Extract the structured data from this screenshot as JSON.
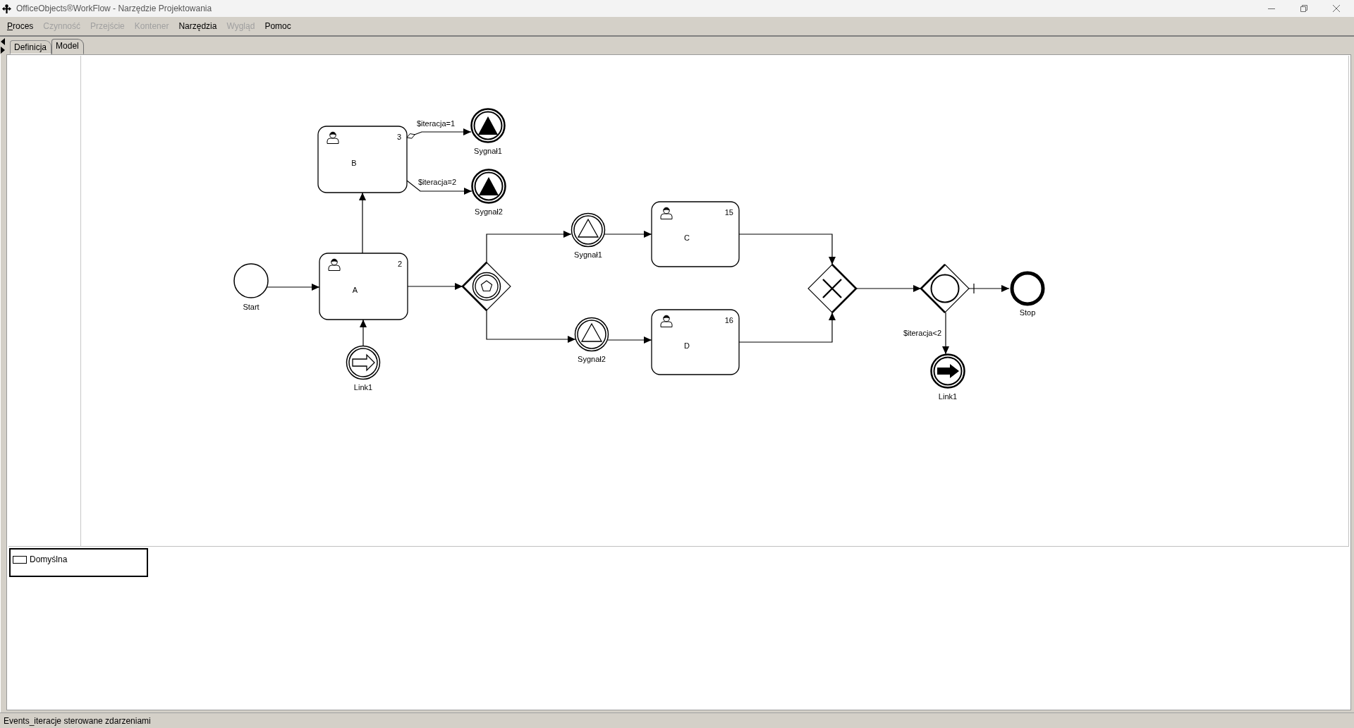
{
  "window": {
    "title": "OfficeObjects®WorkFlow - Narzędzie Projektowania"
  },
  "menu": [
    {
      "label": "Proces",
      "disabled": false,
      "mnemonic_underlined": true
    },
    {
      "label": "Czynność",
      "disabled": true,
      "mnemonic_underlined": false
    },
    {
      "label": "Przejście",
      "disabled": true,
      "mnemonic_underlined": false
    },
    {
      "label": "Kontener",
      "disabled": true,
      "mnemonic_underlined": false
    },
    {
      "label": "Narzędzia",
      "disabled": false,
      "mnemonic_underlined": false
    },
    {
      "label": "Wygląd",
      "disabled": true,
      "mnemonic_underlined": false
    },
    {
      "label": "Pomoc",
      "disabled": false,
      "mnemonic_underlined": false
    }
  ],
  "tabs": [
    {
      "label": "Definicja",
      "selected": false
    },
    {
      "label": "Model",
      "selected": true
    }
  ],
  "diagram": {
    "nodes": [
      {
        "kind": "task",
        "label": "B",
        "number": "3"
      },
      {
        "kind": "signal_end",
        "label": "Sygnał1"
      },
      {
        "kind": "signal_end",
        "label": "Sygnał2"
      },
      {
        "kind": "signal_catch",
        "label": "Sygnał1"
      },
      {
        "kind": "task",
        "label": "C",
        "number": "15"
      },
      {
        "kind": "start",
        "label": "Start"
      },
      {
        "kind": "task",
        "label": "A",
        "number": "2"
      },
      {
        "kind": "event_gateway"
      },
      {
        "kind": "exclusive_gateway"
      },
      {
        "kind": "inclusive_gateway"
      },
      {
        "kind": "end",
        "label": "Stop"
      },
      {
        "kind": "signal_catch",
        "label": "Sygnał2"
      },
      {
        "kind": "task",
        "label": "D",
        "number": "16"
      },
      {
        "kind": "link_catch",
        "label": "Link1"
      },
      {
        "kind": "link_end",
        "label": "Link1"
      }
    ],
    "flows": [
      {
        "kind": "conditional",
        "label": "$iteracja=1"
      },
      {
        "kind": "sequence",
        "label": "$iteracja=2"
      },
      {
        "kind": "sequence"
      },
      {
        "kind": "sequence"
      },
      {
        "kind": "sequence"
      },
      {
        "kind": "sequence"
      },
      {
        "kind": "sequence"
      },
      {
        "kind": "sequence"
      },
      {
        "kind": "sequence"
      },
      {
        "kind": "sequence"
      },
      {
        "kind": "sequence"
      },
      {
        "kind": "default"
      },
      {
        "kind": "sequence"
      },
      {
        "kind": "sequence"
      },
      {
        "kind": "sequence",
        "label": "$iteracja<2"
      }
    ]
  },
  "lanes": [
    {
      "label": "Domyślna"
    }
  ],
  "status_bar": {
    "text": "Events_iteracje sterowane zdarzeniami"
  }
}
